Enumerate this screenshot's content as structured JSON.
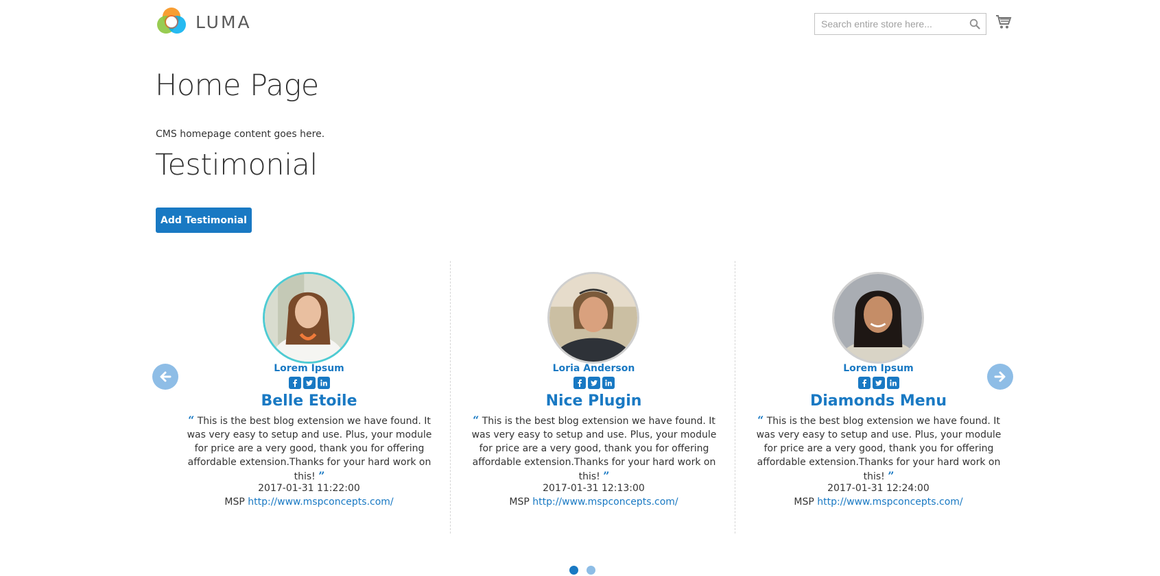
{
  "header": {
    "logo_text": "LUMA",
    "search": {
      "placeholder": "Search entire store here..."
    }
  },
  "page": {
    "title": "Home Page",
    "cms_text": "CMS homepage content goes here."
  },
  "testimonial": {
    "title": "Testimonial",
    "add_button_label": "Add Testimonial",
    "items": [
      {
        "author": "Lorem Ipsum",
        "product": "Belle Etoile",
        "quote": "This is the best blog extension we have found. It was very easy to setup and use. Plus, your module for price are a very good, thank you for offering affordable extension.Thanks for your hard work on this!",
        "date": "2017-01-31 11:22:00",
        "company": "MSP",
        "url": "http://www.mspconcepts.com/"
      },
      {
        "author": "Loria Anderson",
        "product": "Nice Plugin",
        "quote": "This is the best blog extension we have found. It was very easy to setup and use. Plus, your module for price are a very good, thank you for offering affordable extension.Thanks for your hard work on this!",
        "date": "2017-01-31 12:13:00",
        "company": "MSP",
        "url": "http://www.mspconcepts.com/"
      },
      {
        "author": "Lorem Ipsum",
        "product": "Diamonds Menu",
        "quote": "This is the best blog extension we have found. It was very easy to setup and use. Plus, your module for price are a very good, thank you for offering affordable extension.Thanks for your hard work on this!",
        "date": "2017-01-31 12:24:00",
        "company": "MSP",
        "url": "http://www.mspconcepts.com/"
      }
    ],
    "pagination": {
      "pages": 2,
      "active": 1
    }
  },
  "colors": {
    "accent": "#1979c3",
    "accent_light": "#8ebde6",
    "text": "#333333",
    "avatar_active_ring": "#4ecbd3"
  },
  "icons": [
    "luma-logo-icon",
    "search-icon",
    "cart-icon",
    "facebook-icon",
    "twitter-icon",
    "linkedin-icon",
    "quote-open-icon",
    "quote-close-icon",
    "arrow-left-icon",
    "arrow-right-icon"
  ]
}
